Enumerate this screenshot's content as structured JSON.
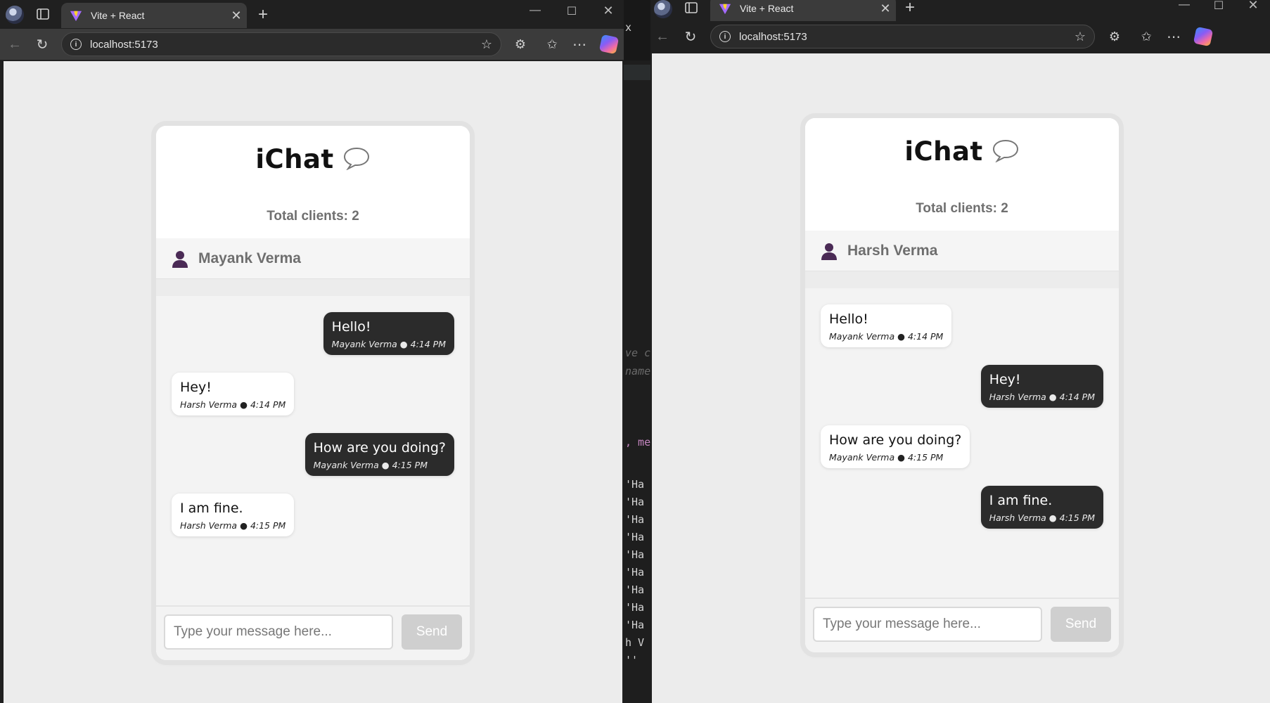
{
  "browser": {
    "tab_title": "Vite + React",
    "url": "localhost:5173"
  },
  "editor_fragments": {
    "lines": [
      "x",
      "ve c",
      "name",
      ", me",
      "'Ha",
      "'Ha",
      "'Ha",
      "'Ha",
      "'Ha",
      "'Ha",
      "'Ha",
      "'Ha",
      "'Ha",
      "h V",
      "''"
    ]
  },
  "left": {
    "app_title": "iChat",
    "total_clients": "Total clients: 2",
    "user_name": "Mayank Verma",
    "messages": [
      {
        "text": "Hello!",
        "meta": "Mayank Verma ● 4:14 PM",
        "own": true
      },
      {
        "text": "Hey!",
        "meta": "Harsh Verma ● 4:14 PM",
        "own": false
      },
      {
        "text": "How are you doing?",
        "meta": "Mayank Verma ● 4:15 PM",
        "own": true
      },
      {
        "text": "I am fine.",
        "meta": "Harsh Verma ● 4:15 PM",
        "own": false
      }
    ],
    "input_placeholder": "Type your message here...",
    "send_label": "Send"
  },
  "right": {
    "app_title": "iChat",
    "total_clients": "Total clients: 2",
    "user_name": "Harsh Verma",
    "messages": [
      {
        "text": "Hello!",
        "meta": "Mayank Verma ● 4:14 PM",
        "own": false
      },
      {
        "text": "Hey!",
        "meta": "Harsh Verma ● 4:14 PM",
        "own": true
      },
      {
        "text": "How are you doing?",
        "meta": "Mayank Verma ● 4:15 PM",
        "own": false
      },
      {
        "text": "I am fine.",
        "meta": "Harsh Verma ● 4:15 PM",
        "own": true
      }
    ],
    "input_placeholder": "Type your message here...",
    "send_label": "Send"
  },
  "colors": {
    "chrome_bg": "#202020",
    "toolbar_bg": "#3b3b3b",
    "page_bg": "#ececec",
    "bubble_own": "#2b2b2b",
    "bubble_other": "#ffffff",
    "user_icon": "#4a2a55",
    "send_disabled": "#cfcfcf"
  },
  "icons": [
    "profile-icon",
    "sidebar-icon",
    "vite-icon",
    "close-icon",
    "plus-icon",
    "minimize-icon",
    "maximize-icon",
    "back-icon",
    "refresh-icon",
    "info-icon",
    "star-icon",
    "extensions-icon",
    "favorites-icon",
    "more-icon",
    "copilot-icon",
    "chat-bubble-icon",
    "user-icon"
  ]
}
